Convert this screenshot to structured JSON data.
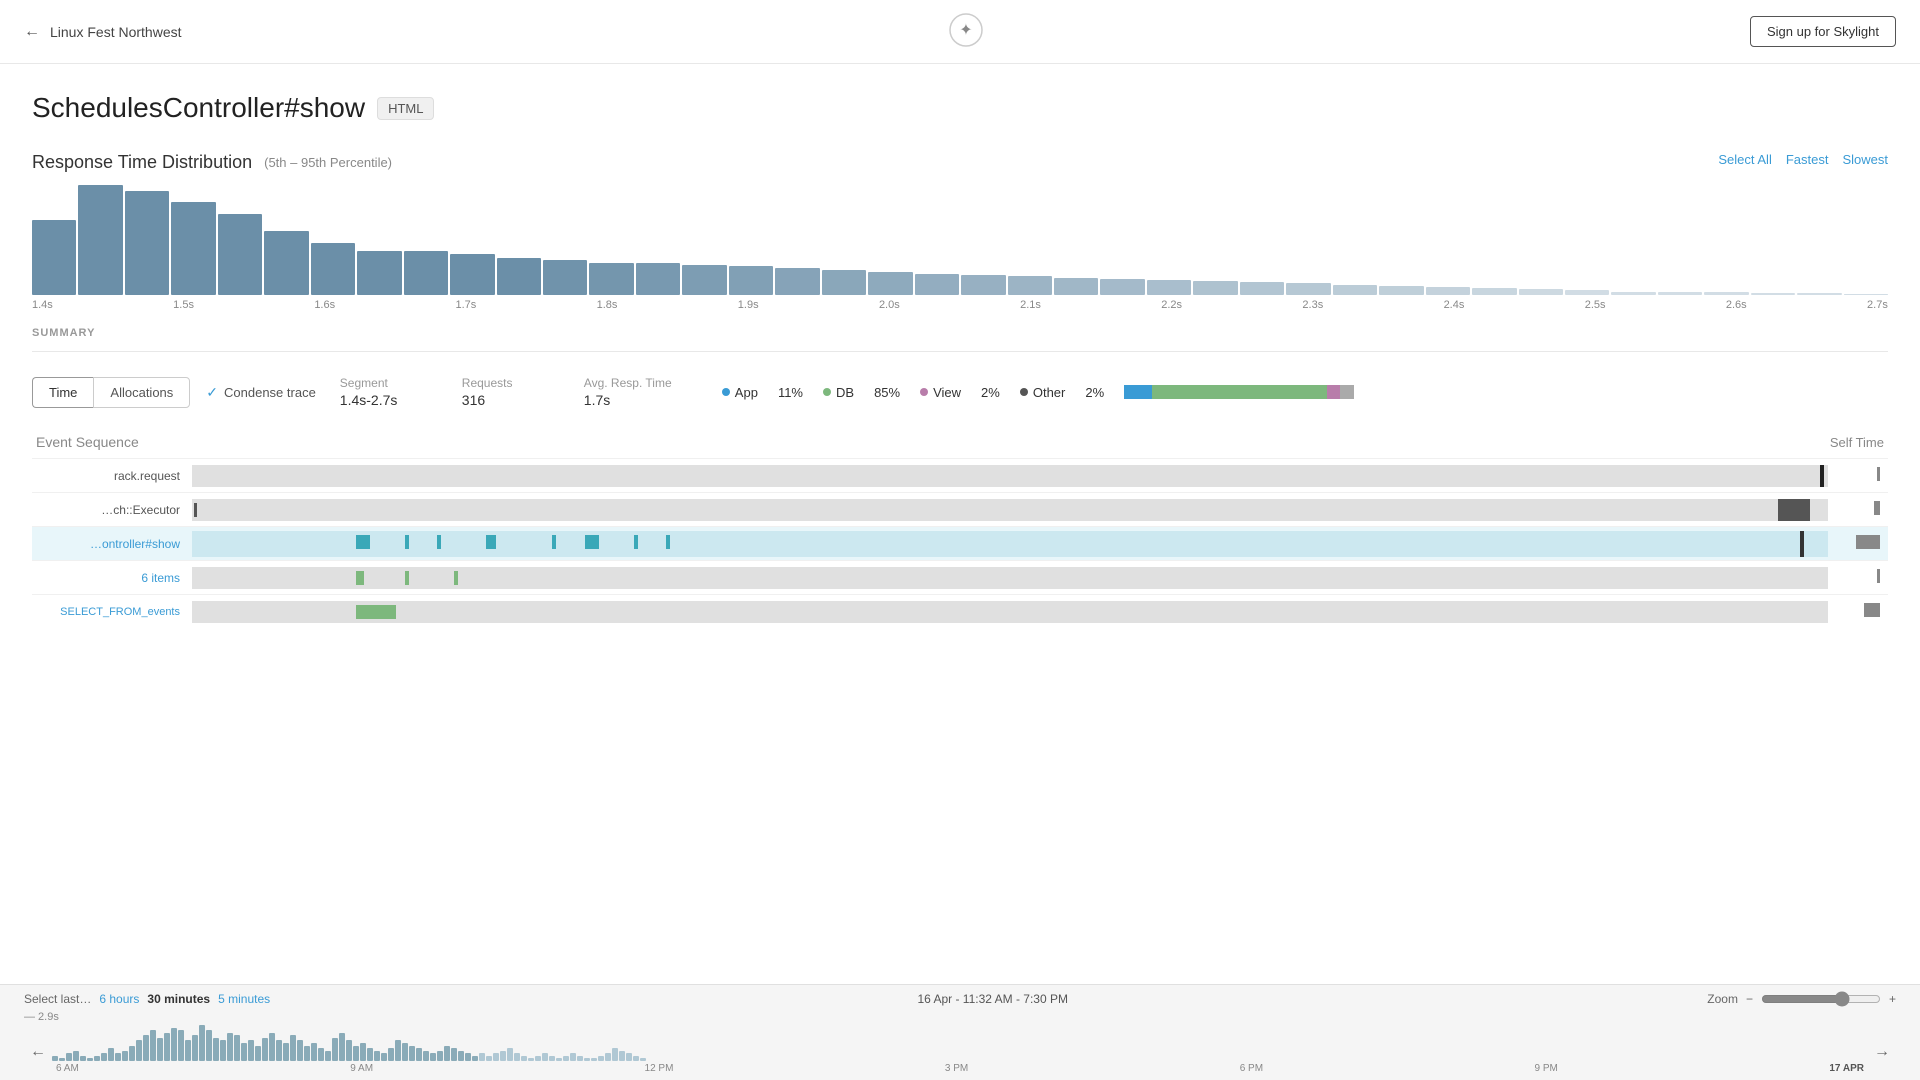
{
  "header": {
    "back_label": "Linux Fest Northwest",
    "logo_icon": "star-icon",
    "signup_label": "Sign up for Skylight"
  },
  "page": {
    "title": "SchedulesController#show",
    "badge": "HTML"
  },
  "chart": {
    "title": "Response Time Distribution",
    "subtitle": "(5th – 95th Percentile)",
    "links": {
      "select_all": "Select All",
      "fastest": "Fastest",
      "slowest": "Slowest"
    },
    "x_labels": [
      "1.4s",
      "1.5s",
      "1.6s",
      "1.7s",
      "1.8s",
      "1.9s",
      "2.0s",
      "2.1s",
      "2.2s",
      "2.3s",
      "2.4s",
      "2.5s",
      "2.6s",
      "2.7s"
    ],
    "bars": [
      65,
      95,
      90,
      80,
      70,
      55,
      45,
      38,
      38,
      35,
      32,
      30,
      28,
      28,
      26,
      25,
      23,
      22,
      20,
      18,
      17,
      16,
      15,
      14,
      13,
      12,
      11,
      10,
      9,
      8,
      7,
      6,
      5,
      4,
      3,
      3,
      3,
      2,
      2,
      1
    ]
  },
  "summary": {
    "label": "SUMMARY",
    "tabs": [
      "Time",
      "Allocations"
    ],
    "active_tab": "Time",
    "condense_trace_label": "Condense trace",
    "columns": {
      "segment": {
        "header": "Segment",
        "value": "1.4s-2.7s"
      },
      "requests": {
        "header": "Requests",
        "value": "316"
      },
      "avg_resp": {
        "header": "Avg. Resp. Time",
        "value": "1.7s"
      }
    },
    "legend": [
      {
        "label": "App",
        "value": "11%",
        "color": "#3a9bd5"
      },
      {
        "label": "DB",
        "value": "85%",
        "color": "#7db87d"
      },
      {
        "label": "View",
        "value": "2%",
        "color": "#b87daa"
      },
      {
        "label": "Other",
        "value": "2%",
        "color": "#555"
      }
    ],
    "bar_segments": [
      {
        "label": "App",
        "width": 12,
        "color": "#3a9bd5"
      },
      {
        "label": "DB",
        "width": 76,
        "color": "#7db87d"
      },
      {
        "label": "View",
        "width": 6,
        "color": "#b87daa"
      },
      {
        "label": "Other",
        "width": 6,
        "color": "#aaa"
      }
    ]
  },
  "events": {
    "title": "Event Sequence",
    "self_time_label": "Self Time",
    "rows": [
      {
        "name": "rack.request",
        "type": "gray",
        "self_time": ""
      },
      {
        "name": "…ch::Executor",
        "type": "gray-dark",
        "self_time": ""
      },
      {
        "name": "…ontroller#show",
        "type": "teal-bg",
        "self_time": ""
      },
      {
        "name": "6 items",
        "type": "green",
        "self_time": ""
      },
      {
        "name": "SELECT_FROM_events",
        "type": "green-small",
        "self_time": ""
      }
    ]
  },
  "timeline": {
    "select_label": "Select last…",
    "periods": [
      "6 hours",
      "30 minutes",
      "5 minutes"
    ],
    "active_period": "30 minutes",
    "date_range": "16 Apr - 11:32 AM - 7:30 PM",
    "zoom_label": "Zoom",
    "labels": [
      "6 AM",
      "9 AM",
      "12 PM",
      "3 PM",
      "6 PM",
      "9 PM",
      "17 APR"
    ],
    "y_label": "— 2.9s"
  }
}
